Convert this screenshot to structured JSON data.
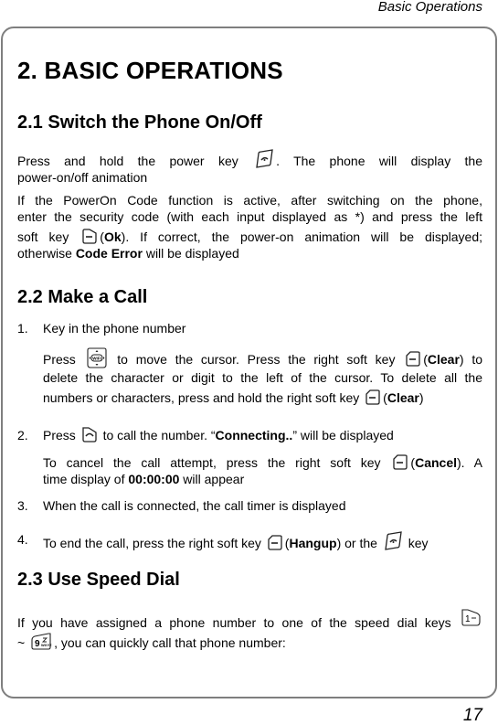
{
  "running_head": "Basic Operations",
  "page_number": "17",
  "chapter_title": "2. BASIC OPERATIONS",
  "sections": [
    {
      "heading": "2.1 Switch the Phone On/Off",
      "p1": {
        "a": "Press and hold the power key",
        "b": ". The phone will display the",
        "c": "power-on/off animation"
      },
      "p2": {
        "l1": "If the PowerOn Code function is active, after switching on the phone,",
        "l2": "enter the security code (with each input displayed as *) and press the left",
        "l3a": "soft key",
        "l3b": "(",
        "l3ok": "Ok",
        "l3c": "). If correct, the power-on animation will be displayed;",
        "l4a": "otherwise ",
        "l4b": "Code Error",
        "l4c": " will be displayed"
      }
    },
    {
      "heading": "2.2 Make a Call",
      "steps": [
        {
          "num": "1.",
          "text": "Key in the phone number",
          "sub": {
            "l1a": "Press",
            "l1b": "to move the cursor. Press the right soft key",
            "l1c": "(",
            "l1bold": "Clear",
            "l1d": ") to",
            "l2": "delete the character or digit to the left of the cursor. To delete all the",
            "l3a": "numbers or characters, press and hold the right soft key",
            "l3b": "(",
            "l3bold": "Clear",
            "l3c": ")"
          }
        },
        {
          "num": "2.",
          "a": "Press",
          "b": "to call the number. “",
          "bold": "Connecting..",
          "c": "” will be displayed",
          "sub": {
            "l1a": "To cancel the call attempt, press the right soft key",
            "l1b": "(",
            "l1bold": "Cancel",
            "l1c": "). A",
            "l2a": "time display of ",
            "l2bold": "00:00:00",
            "l2c": " will appear"
          }
        },
        {
          "num": "3.",
          "text": "When the call is connected, the call timer is displayed"
        },
        {
          "num": "4.",
          "a": "To end the call, press the right soft key",
          "b": "(",
          "bold": "Hangup",
          "c": ") or the",
          "d": "key"
        }
      ]
    },
    {
      "heading": "2.3 Use Speed Dial",
      "p1": {
        "l1": "If you have assigned a phone number to one of the speed dial keys",
        "l2a": "~",
        "l2b": ", you can quickly call that phone number:"
      }
    }
  ],
  "icons": {
    "power_key": "power-end-key-icon",
    "left_soft_key": "left-soft-key-icon",
    "right_soft_key": "right-soft-key-icon",
    "nav_key": "navigation-wifi-key-icon",
    "send_key": "send-call-key-icon",
    "key_1": "key-1-icon",
    "key_9": "key-9-wxyz-icon"
  },
  "key_labels": {
    "nav": "WIFI",
    "one": "1",
    "nine": "9",
    "nine_sub": "WXYZ"
  }
}
